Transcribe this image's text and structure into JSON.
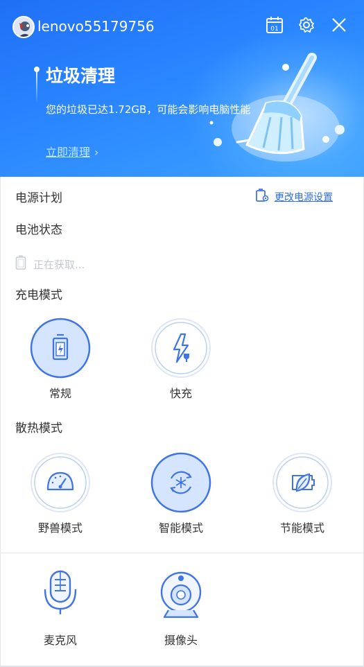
{
  "header": {
    "username": "lenovo55179756",
    "calendar_day": "01",
    "title": "垃圾清理",
    "description": "您的垃圾已达1.72GB，可能会影响电脑性能",
    "cta": "立即清理",
    "cta_chevron": "›"
  },
  "icons": {
    "calendar": "calendar-icon",
    "settings": "gear-icon",
    "close": "close-icon",
    "broom": "broom-illustration",
    "power": "power-plan-icon",
    "battery": "battery-icon"
  },
  "power": {
    "label": "电源计划",
    "change_link": "更改电源设置"
  },
  "battery": {
    "label": "电池状态",
    "status": "正在获取..."
  },
  "charge": {
    "label": "充电模式",
    "modes": [
      {
        "label": "常规",
        "selected": true,
        "icon": "battery-charging-icon"
      },
      {
        "label": "快充",
        "selected": false,
        "icon": "fast-charge-icon"
      }
    ]
  },
  "thermal": {
    "label": "散热模式",
    "modes": [
      {
        "label": "野兽模式",
        "selected": false,
        "icon": "speedometer-icon"
      },
      {
        "label": "智能模式",
        "selected": true,
        "icon": "smart-fan-icon"
      },
      {
        "label": "节能模式",
        "selected": false,
        "icon": "leaf-battery-icon"
      }
    ]
  },
  "devices": [
    {
      "label": "麦克风",
      "icon": "microphone-icon"
    },
    {
      "label": "摄像头",
      "icon": "camera-icon"
    }
  ],
  "colors": {
    "header_start": "#1f6ff6",
    "header_end": "#3da2ff",
    "accent": "#2d6ee8",
    "selected_fill": "#d6e5ff",
    "icon_stroke": "#3f74e6"
  }
}
